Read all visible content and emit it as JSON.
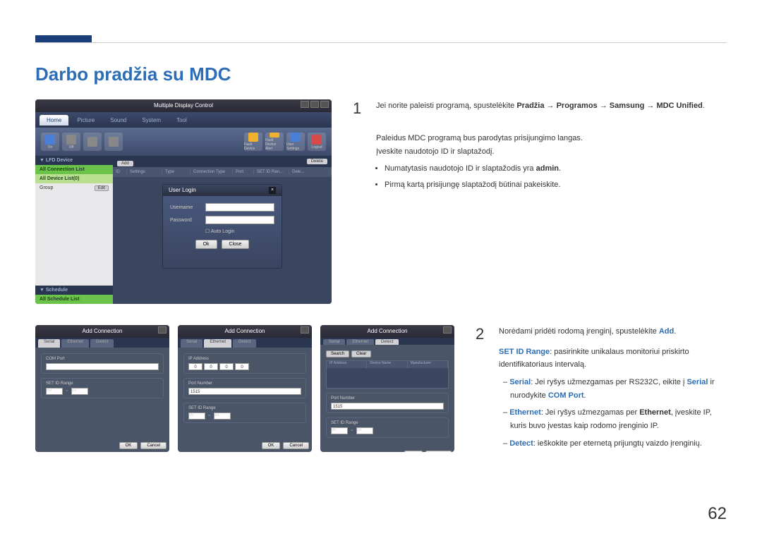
{
  "page": {
    "title": "Darbo pradžia su MDC",
    "number": "62"
  },
  "mdc": {
    "window_title": "Multiple Display Control",
    "tabs": [
      "Home",
      "Picture",
      "Sound",
      "System",
      "Tool"
    ],
    "toolbar_on_label": "On",
    "toolbar_off_label": "Off",
    "tool_fault": "Fault Device",
    "tool_fault_alert": "Fault Device Alert",
    "tool_user_settings": "User Settings",
    "tool_logout": "Logout",
    "sidebar": {
      "lfd_header": "▼ LFD Device",
      "all_conn_header": "All Connection List",
      "all_device_header": "All Device List(0)",
      "group_label": "Group",
      "edit_btn": "Edit",
      "schedule_header": "▼ Schedule",
      "all_schedule_header": "All Schedule List"
    },
    "subbar": {
      "add": "Add",
      "delete": "Delete"
    },
    "cols": [
      "ID",
      "Settings",
      "Type",
      "Connection Type",
      "Port",
      "SET ID Ran...",
      "Dele..."
    ],
    "login": {
      "title": "User Login",
      "username": "Username",
      "password": "Password",
      "auto": "Auto Login",
      "ok": "Ok",
      "close": "Close"
    }
  },
  "addconn": {
    "title": "Add Connection",
    "tabs": [
      "Serial",
      "Ethernet",
      "Detect"
    ],
    "com_port": "COM Port",
    "set_id_range": "SET ID Range",
    "range_from": "00",
    "range_to": "10",
    "ip_address": "IP Address",
    "ip_zero": [
      "0",
      "0",
      "0",
      "0"
    ],
    "port_number": "Port Number",
    "port_val": "1515",
    "search": "Search",
    "clear": "Clear",
    "cols": [
      "IP Address",
      "Device Name",
      "Manufacturer"
    ],
    "ok": "OK",
    "cancel": "Cancel"
  },
  "step1": {
    "num": "1",
    "lead": "Jei norite paleisti programą, spustelėkite ",
    "path1": "Pradžia",
    "path2": "Programos",
    "path3": "Samsung",
    "path4": "MDC Unified",
    "p2": "Paleidus MDC programą bus parodytas prisijungimo langas.",
    "p3": "Įveskite naudotojo ID ir slaptažodį.",
    "b1a": "Numatytasis naudotojo ID ir slaptažodis yra ",
    "b1b": "admin",
    "b2": "Pirmą kartą prisijungę slaptažodį būtinai pakeiskite."
  },
  "step2": {
    "num": "2",
    "lead": "Norėdami pridėti rodomą įrenginį, spustelėkite ",
    "add": "Add",
    "p2a": "SET ID Range",
    "p2b": ": pasirinkite unikalaus monitoriui priskirto identifikatoriaus intervalą.",
    "d1a": "Serial",
    "d1b": ": Jei ryšys užmezgamas per RS232C, eikite į ",
    "d1c": "Serial",
    "d1d": " ir nurodykite ",
    "d1e": "COM Port",
    "d2a": "Ethernet",
    "d2b": ": Jei ryšys užmezgamas per ",
    "d2c": "Ethernet",
    "d2d": ", įveskite IP, kuris buvo įvestas kaip rodomo įrenginio IP.",
    "d3a": "Detect",
    "d3b": ": ieškokite per eternetą prijungtų vaizdo įrenginių."
  }
}
